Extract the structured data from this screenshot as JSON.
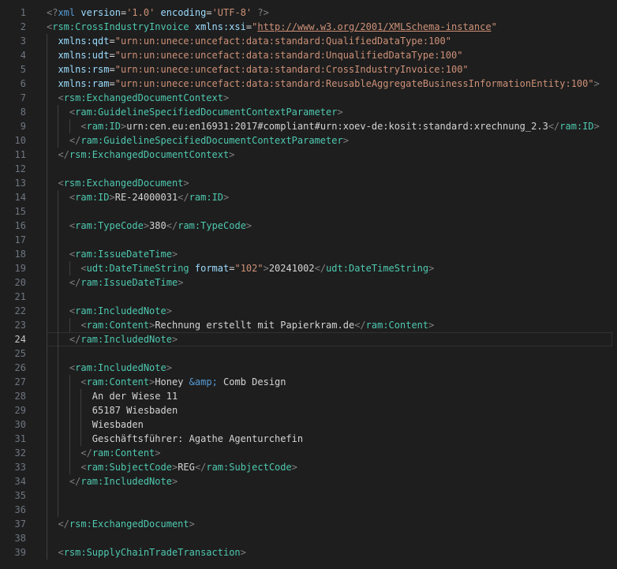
{
  "editor": {
    "current_line": 24,
    "lines": [
      {
        "n": "1",
        "indent": 0,
        "tokens": [
          {
            "c": "t-pi",
            "t": "<?"
          },
          {
            "c": "t-tag",
            "t": "xml"
          },
          {
            "c": "t-text",
            "t": " "
          },
          {
            "c": "t-attr",
            "t": "version"
          },
          {
            "c": "t-eq",
            "t": "="
          },
          {
            "c": "t-str",
            "t": "'1.0'"
          },
          {
            "c": "t-text",
            "t": " "
          },
          {
            "c": "t-attr",
            "t": "encoding"
          },
          {
            "c": "t-eq",
            "t": "="
          },
          {
            "c": "t-str",
            "t": "'UTF-8'"
          },
          {
            "c": "t-text",
            "t": " "
          },
          {
            "c": "t-pi",
            "t": "?>"
          }
        ]
      },
      {
        "n": "2",
        "indent": 0,
        "tokens": [
          {
            "c": "t-bracket",
            "t": "<"
          },
          {
            "c": "t-ns",
            "t": "rsm:CrossIndustryInvoice"
          },
          {
            "c": "t-text",
            "t": " "
          },
          {
            "c": "t-attr",
            "t": "xmlns:xsi"
          },
          {
            "c": "t-eq",
            "t": "="
          },
          {
            "c": "t-str",
            "t": "\""
          },
          {
            "c": "t-url",
            "t": "http://www.w3.org/2001/XMLSchema-instance"
          },
          {
            "c": "t-str",
            "t": "\""
          }
        ]
      },
      {
        "n": "3",
        "indent": 1,
        "tokens": [
          {
            "c": "t-attr",
            "t": "xmlns:qdt"
          },
          {
            "c": "t-eq",
            "t": "="
          },
          {
            "c": "t-str",
            "t": "\"urn:un:unece:uncefact:data:standard:QualifiedDataType:100\""
          }
        ]
      },
      {
        "n": "4",
        "indent": 1,
        "tokens": [
          {
            "c": "t-attr",
            "t": "xmlns:udt"
          },
          {
            "c": "t-eq",
            "t": "="
          },
          {
            "c": "t-str",
            "t": "\"urn:un:unece:uncefact:data:standard:UnqualifiedDataType:100\""
          }
        ]
      },
      {
        "n": "5",
        "indent": 1,
        "tokens": [
          {
            "c": "t-attr",
            "t": "xmlns:rsm"
          },
          {
            "c": "t-eq",
            "t": "="
          },
          {
            "c": "t-str",
            "t": "\"urn:un:unece:uncefact:data:standard:CrossIndustryInvoice:100\""
          }
        ]
      },
      {
        "n": "6",
        "indent": 1,
        "tokens": [
          {
            "c": "t-attr",
            "t": "xmlns:ram"
          },
          {
            "c": "t-eq",
            "t": "="
          },
          {
            "c": "t-str",
            "t": "\"urn:un:unece:uncefact:data:standard:ReusableAggregateBusinessInformationEntity:100\""
          },
          {
            "c": "t-bracket",
            "t": ">"
          }
        ]
      },
      {
        "n": "7",
        "indent": 1,
        "tokens": [
          {
            "c": "t-bracket",
            "t": "<"
          },
          {
            "c": "t-ns",
            "t": "rsm:ExchangedDocumentContext"
          },
          {
            "c": "t-bracket",
            "t": ">"
          }
        ]
      },
      {
        "n": "8",
        "indent": 2,
        "tokens": [
          {
            "c": "t-bracket",
            "t": "<"
          },
          {
            "c": "t-ns",
            "t": "ram:GuidelineSpecifiedDocumentContextParameter"
          },
          {
            "c": "t-bracket",
            "t": ">"
          }
        ]
      },
      {
        "n": "9",
        "indent": 3,
        "tokens": [
          {
            "c": "t-bracket",
            "t": "<"
          },
          {
            "c": "t-ns",
            "t": "ram:ID"
          },
          {
            "c": "t-bracket",
            "t": ">"
          },
          {
            "c": "t-text",
            "t": "urn:cen.eu:en16931:2017#compliant#urn:xoev-de:kosit:standard:xrechnung_2.3"
          },
          {
            "c": "t-bracket",
            "t": "</"
          },
          {
            "c": "t-ns",
            "t": "ram:ID"
          },
          {
            "c": "t-bracket",
            "t": ">"
          }
        ]
      },
      {
        "n": "10",
        "indent": 2,
        "tokens": [
          {
            "c": "t-bracket",
            "t": "</"
          },
          {
            "c": "t-ns",
            "t": "ram:GuidelineSpecifiedDocumentContextParameter"
          },
          {
            "c": "t-bracket",
            "t": ">"
          }
        ]
      },
      {
        "n": "11",
        "indent": 1,
        "tokens": [
          {
            "c": "t-bracket",
            "t": "</"
          },
          {
            "c": "t-ns",
            "t": "rsm:ExchangedDocumentContext"
          },
          {
            "c": "t-bracket",
            "t": ">"
          }
        ]
      },
      {
        "n": "12",
        "indent": 1,
        "tokens": []
      },
      {
        "n": "13",
        "indent": 1,
        "tokens": [
          {
            "c": "t-bracket",
            "t": "<"
          },
          {
            "c": "t-ns",
            "t": "rsm:ExchangedDocument"
          },
          {
            "c": "t-bracket",
            "t": ">"
          }
        ]
      },
      {
        "n": "14",
        "indent": 2,
        "tokens": [
          {
            "c": "t-bracket",
            "t": "<"
          },
          {
            "c": "t-ns",
            "t": "ram:ID"
          },
          {
            "c": "t-bracket",
            "t": ">"
          },
          {
            "c": "t-text",
            "t": "RE-24000031"
          },
          {
            "c": "t-bracket",
            "t": "</"
          },
          {
            "c": "t-ns",
            "t": "ram:ID"
          },
          {
            "c": "t-bracket",
            "t": ">"
          }
        ]
      },
      {
        "n": "15",
        "indent": 2,
        "tokens": []
      },
      {
        "n": "16",
        "indent": 2,
        "tokens": [
          {
            "c": "t-bracket",
            "t": "<"
          },
          {
            "c": "t-ns",
            "t": "ram:TypeCode"
          },
          {
            "c": "t-bracket",
            "t": ">"
          },
          {
            "c": "t-text",
            "t": "380"
          },
          {
            "c": "t-bracket",
            "t": "</"
          },
          {
            "c": "t-ns",
            "t": "ram:TypeCode"
          },
          {
            "c": "t-bracket",
            "t": ">"
          }
        ]
      },
      {
        "n": "17",
        "indent": 2,
        "tokens": []
      },
      {
        "n": "18",
        "indent": 2,
        "tokens": [
          {
            "c": "t-bracket",
            "t": "<"
          },
          {
            "c": "t-ns",
            "t": "ram:IssueDateTime"
          },
          {
            "c": "t-bracket",
            "t": ">"
          }
        ]
      },
      {
        "n": "19",
        "indent": 3,
        "tokens": [
          {
            "c": "t-bracket",
            "t": "<"
          },
          {
            "c": "t-ns",
            "t": "udt:DateTimeString"
          },
          {
            "c": "t-text",
            "t": " "
          },
          {
            "c": "t-attr",
            "t": "format"
          },
          {
            "c": "t-eq",
            "t": "="
          },
          {
            "c": "t-str",
            "t": "\"102\""
          },
          {
            "c": "t-bracket",
            "t": ">"
          },
          {
            "c": "t-text",
            "t": "20241002"
          },
          {
            "c": "t-bracket",
            "t": "</"
          },
          {
            "c": "t-ns",
            "t": "udt:DateTimeString"
          },
          {
            "c": "t-bracket",
            "t": ">"
          }
        ]
      },
      {
        "n": "20",
        "indent": 2,
        "tokens": [
          {
            "c": "t-bracket",
            "t": "</"
          },
          {
            "c": "t-ns",
            "t": "ram:IssueDateTime"
          },
          {
            "c": "t-bracket",
            "t": ">"
          }
        ]
      },
      {
        "n": "21",
        "indent": 2,
        "tokens": []
      },
      {
        "n": "22",
        "indent": 2,
        "tokens": [
          {
            "c": "t-bracket",
            "t": "<"
          },
          {
            "c": "t-ns",
            "t": "ram:IncludedNote"
          },
          {
            "c": "t-bracket",
            "t": ">"
          }
        ]
      },
      {
        "n": "23",
        "indent": 3,
        "tokens": [
          {
            "c": "t-bracket",
            "t": "<"
          },
          {
            "c": "t-ns",
            "t": "ram:Content"
          },
          {
            "c": "t-bracket",
            "t": ">"
          },
          {
            "c": "t-text",
            "t": "Rechnung erstellt mit Papierkram.de"
          },
          {
            "c": "t-bracket",
            "t": "</"
          },
          {
            "c": "t-ns",
            "t": "ram:Content"
          },
          {
            "c": "t-bracket",
            "t": ">"
          }
        ]
      },
      {
        "n": "24",
        "indent": 2,
        "tokens": [
          {
            "c": "t-bracket",
            "t": "</"
          },
          {
            "c": "t-ns",
            "t": "ram:IncludedNote"
          },
          {
            "c": "t-bracket",
            "t": ">"
          }
        ]
      },
      {
        "n": "25",
        "indent": 2,
        "tokens": []
      },
      {
        "n": "26",
        "indent": 2,
        "tokens": [
          {
            "c": "t-bracket",
            "t": "<"
          },
          {
            "c": "t-ns",
            "t": "ram:IncludedNote"
          },
          {
            "c": "t-bracket",
            "t": ">"
          }
        ]
      },
      {
        "n": "27",
        "indent": 3,
        "tokens": [
          {
            "c": "t-bracket",
            "t": "<"
          },
          {
            "c": "t-ns",
            "t": "ram:Content"
          },
          {
            "c": "t-bracket",
            "t": ">"
          },
          {
            "c": "t-text",
            "t": "Honey "
          },
          {
            "c": "t-tag",
            "t": "&amp;"
          },
          {
            "c": "t-text",
            "t": " Comb Design"
          }
        ]
      },
      {
        "n": "28",
        "indent": 4,
        "tokens": [
          {
            "c": "t-text",
            "t": "An der Wiese 11"
          }
        ]
      },
      {
        "n": "29",
        "indent": 4,
        "tokens": [
          {
            "c": "t-text",
            "t": "65187 Wiesbaden"
          }
        ]
      },
      {
        "n": "30",
        "indent": 4,
        "tokens": [
          {
            "c": "t-text",
            "t": "Wiesbaden"
          }
        ]
      },
      {
        "n": "31",
        "indent": 4,
        "tokens": [
          {
            "c": "t-text",
            "t": "Geschäftsführer: Agathe Agenturchefin"
          }
        ]
      },
      {
        "n": "32",
        "indent": 3,
        "tokens": [
          {
            "c": "t-bracket",
            "t": "</"
          },
          {
            "c": "t-ns",
            "t": "ram:Content"
          },
          {
            "c": "t-bracket",
            "t": ">"
          }
        ]
      },
      {
        "n": "33",
        "indent": 3,
        "tokens": [
          {
            "c": "t-bracket",
            "t": "<"
          },
          {
            "c": "t-ns",
            "t": "ram:SubjectCode"
          },
          {
            "c": "t-bracket",
            "t": ">"
          },
          {
            "c": "t-text",
            "t": "REG"
          },
          {
            "c": "t-bracket",
            "t": "</"
          },
          {
            "c": "t-ns",
            "t": "ram:SubjectCode"
          },
          {
            "c": "t-bracket",
            "t": ">"
          }
        ]
      },
      {
        "n": "34",
        "indent": 2,
        "tokens": [
          {
            "c": "t-bracket",
            "t": "</"
          },
          {
            "c": "t-ns",
            "t": "ram:IncludedNote"
          },
          {
            "c": "t-bracket",
            "t": ">"
          }
        ]
      },
      {
        "n": "35",
        "indent": 2,
        "tokens": []
      },
      {
        "n": "36",
        "indent": 2,
        "tokens": []
      },
      {
        "n": "37",
        "indent": 1,
        "tokens": [
          {
            "c": "t-bracket",
            "t": "</"
          },
          {
            "c": "t-ns",
            "t": "rsm:ExchangedDocument"
          },
          {
            "c": "t-bracket",
            "t": ">"
          }
        ]
      },
      {
        "n": "38",
        "indent": 1,
        "tokens": []
      },
      {
        "n": "39",
        "indent": 1,
        "tokens": [
          {
            "c": "t-bracket",
            "t": "<"
          },
          {
            "c": "t-ns",
            "t": "rsm:SupplyChainTradeTransaction"
          },
          {
            "c": "t-bracket",
            "t": ">"
          }
        ]
      }
    ]
  }
}
